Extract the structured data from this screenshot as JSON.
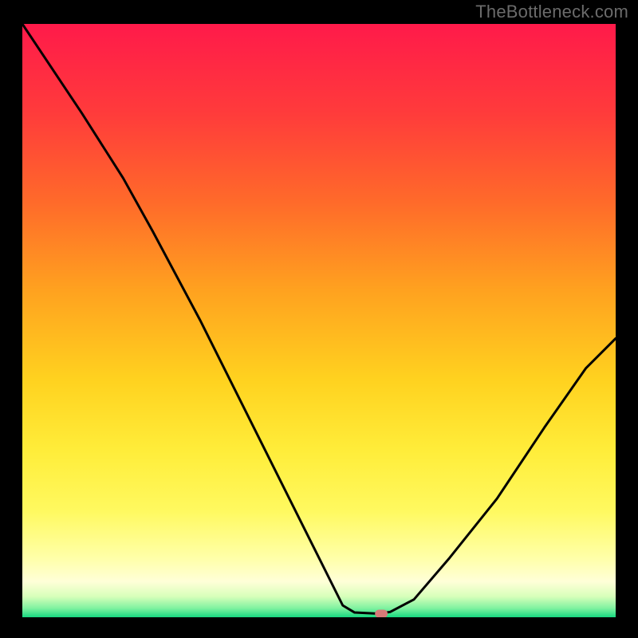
{
  "watermark": "TheBottleneck.com",
  "chart_data": {
    "type": "line",
    "title": "",
    "xlabel": "",
    "ylabel": "",
    "xlim": [
      0,
      100
    ],
    "ylim": [
      0,
      100
    ],
    "grid": false,
    "legend": false,
    "curve": [
      {
        "x": 0,
        "y": 100
      },
      {
        "x": 10,
        "y": 85
      },
      {
        "x": 17,
        "y": 74
      },
      {
        "x": 22,
        "y": 65
      },
      {
        "x": 30,
        "y": 50
      },
      {
        "x": 40,
        "y": 30
      },
      {
        "x": 50,
        "y": 10
      },
      {
        "x": 54,
        "y": 2
      },
      {
        "x": 56,
        "y": 0.8
      },
      {
        "x": 60,
        "y": 0.6
      },
      {
        "x": 62,
        "y": 0.9
      },
      {
        "x": 66,
        "y": 3
      },
      {
        "x": 72,
        "y": 10
      },
      {
        "x": 80,
        "y": 20
      },
      {
        "x": 88,
        "y": 32
      },
      {
        "x": 95,
        "y": 42
      },
      {
        "x": 100,
        "y": 47
      }
    ],
    "marker": {
      "x": 60.5,
      "y": 0.6
    },
    "gradient_stops": [
      {
        "offset": 0.0,
        "color": "#ff1a4a"
      },
      {
        "offset": 0.15,
        "color": "#ff3b3b"
      },
      {
        "offset": 0.3,
        "color": "#ff6a2a"
      },
      {
        "offset": 0.45,
        "color": "#ffa21f"
      },
      {
        "offset": 0.6,
        "color": "#ffd21f"
      },
      {
        "offset": 0.72,
        "color": "#ffed3a"
      },
      {
        "offset": 0.82,
        "color": "#fff95f"
      },
      {
        "offset": 0.9,
        "color": "#ffffa8"
      },
      {
        "offset": 0.94,
        "color": "#ffffd8"
      },
      {
        "offset": 0.965,
        "color": "#d7ffba"
      },
      {
        "offset": 0.985,
        "color": "#7ef2a0"
      },
      {
        "offset": 1.0,
        "color": "#17d880"
      }
    ]
  }
}
